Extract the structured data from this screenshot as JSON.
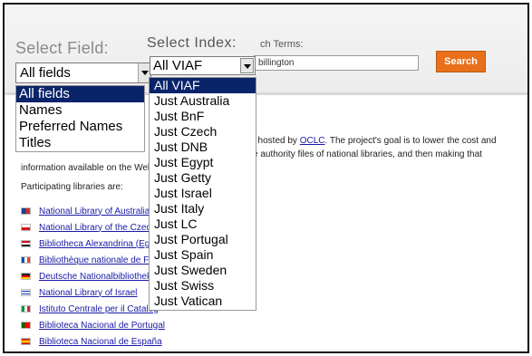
{
  "search_form": {
    "field_label": "Select Field:",
    "field_selected": "All fields",
    "field_options": [
      "All fields",
      "Names",
      "Preferred Names",
      "Titles"
    ],
    "index_label": "Select Index:",
    "index_selected": "All VIAF",
    "index_options": [
      "All VIAF",
      "Just Australia",
      "Just BnF",
      "Just Czech",
      "Just DNB",
      "Just Egypt",
      "Just Getty",
      "Just Israel",
      "Just Italy",
      "Just LC",
      "Just Portugal",
      "Just Spain",
      "Just Sweden",
      "Just Swiss",
      "Just Vatican"
    ],
    "terms_label": "ch Terms:",
    "terms_value": "billington",
    "search_label": "Search"
  },
  "intro": {
    "line1_prefix": "t hosted by",
    "line1_link": "OCLC",
    "line1_suffix": ". The project's goal is to lower the cost and",
    "line2": "e authority files of national libraries, and then making that",
    "line3": "information available on the Web.",
    "participating": "Participating libraries are:"
  },
  "libraries": [
    {
      "name": "National Library of Australia",
      "flag": "australia"
    },
    {
      "name": "National Library of the Czech",
      "flag": "czech"
    },
    {
      "name": "Bibliotheca Alexandrina (Egy",
      "flag": "egypt"
    },
    {
      "name": "Bibliothèque nationale de Fra",
      "flag": "france"
    },
    {
      "name": "Deutsche Nationalbibliothek",
      "flag": "germany"
    },
    {
      "name": "National Library of Israel",
      "flag": "israel"
    },
    {
      "name": "Istituto Centrale per il Catalog",
      "flag": "italy"
    },
    {
      "name": "Biblioteca Nacional de Portugal",
      "flag": "portugal"
    },
    {
      "name": "Biblioteca Nacional de España",
      "flag": "spain"
    }
  ],
  "colors": {
    "highlight": "#0a246a",
    "search_button": "#e8701a",
    "link": "#1a1aa6"
  }
}
